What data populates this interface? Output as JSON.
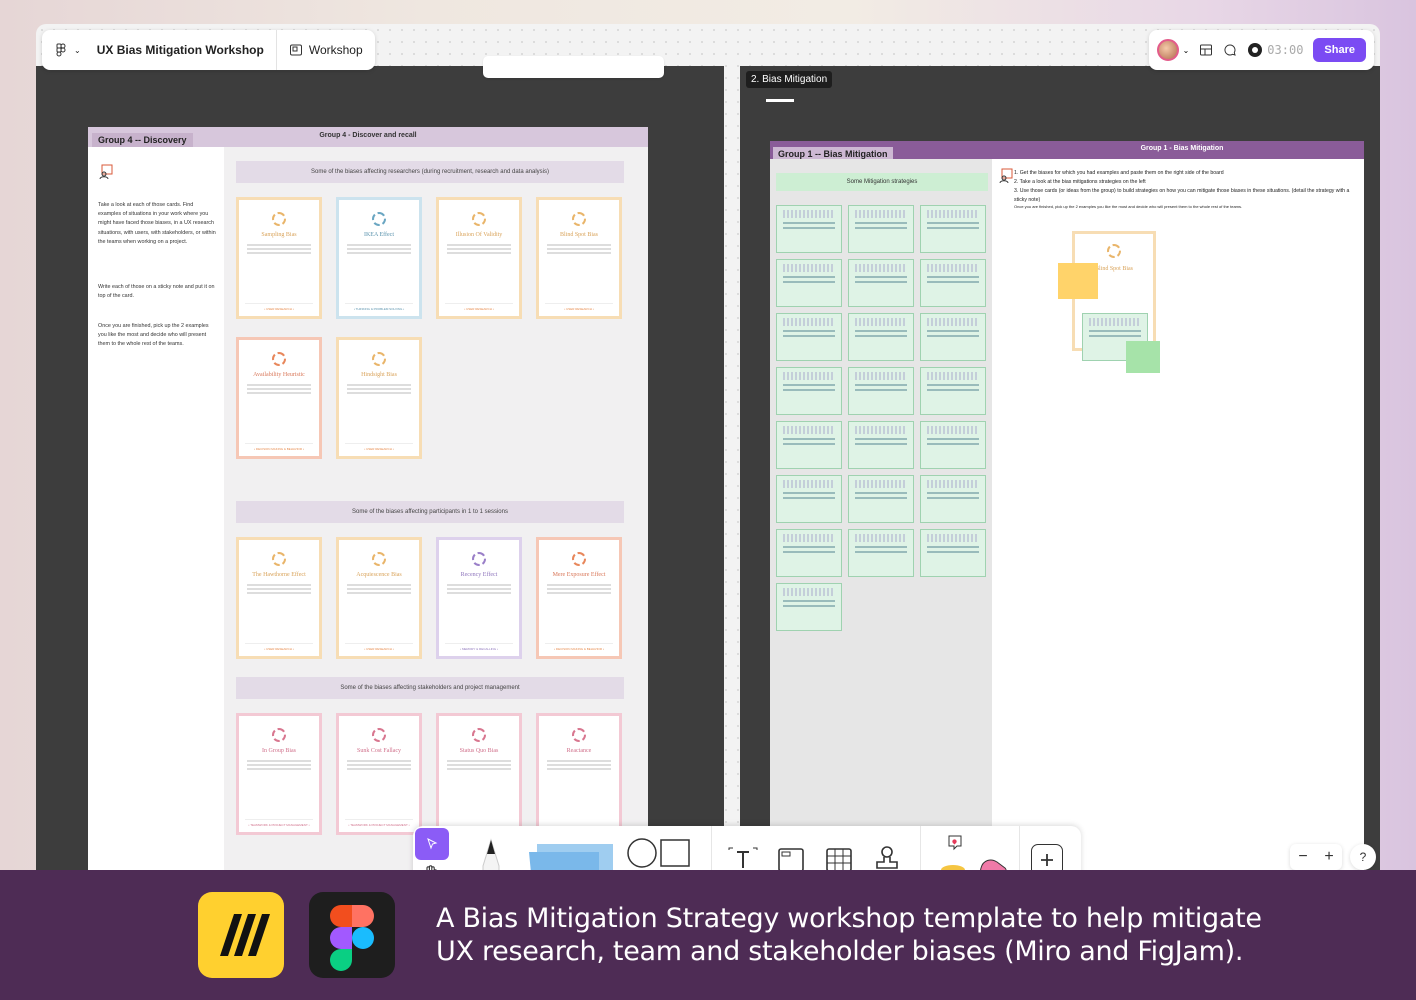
{
  "app": {
    "file_name": "UX Bias Mitigation Workshop",
    "mode_label": "Workshop",
    "timer": "03:00",
    "share_label": "Share"
  },
  "frame_b_label": "2. Bias Mitigation",
  "board_a": {
    "tab": "Group 4 -- Discovery",
    "header": "Group 4 - Discover and recall",
    "side_texts": [
      "Take a look at each of those cards. Find examples of situations in your work where you might have faced those biases, in a UX research situations, with users, with stakeholders, or within the teams when working on a project.",
      "Write each of those on a sticky note and put it on top of the card.",
      "Once you are finished, pick up the 2 examples you like the most and decide who will present them to the whole rest of the teams."
    ],
    "sections": [
      "Some of the biases affecting researchers (during recruitment, research and data analysis)",
      "Some of the biases affecting participants in 1 to 1 sessions",
      "Some of the biases affecting stakeholders and project management"
    ],
    "cards_row1": [
      "Sampling Bias",
      "IKEA Effect",
      "Illusion Of Validity",
      "Blind Spot Bias"
    ],
    "cards_row2": [
      "Availability Heuristic",
      "Hindsight Bias"
    ],
    "cards_row3": [
      "The Hawthorne Effect",
      "Acquiescence Bias",
      "Recency Effect",
      "Mere Exposure Effect"
    ],
    "cards_row4": [
      "In Group Bias",
      "Sunk Cost Fallacy",
      "Status Quo Bias",
      "Reactance"
    ]
  },
  "board_b": {
    "tab": "Group 1 -- Bias Mitigation",
    "header": "Group 1 - Bias Mitigation",
    "section": "Some Mitigation strategies",
    "instructions": [
      "1.  Get the biases for which you had examples and paste them on the right side of the board",
      "2.  Take a look at the bias mitigations strategies on the left",
      "3.  Use those cards (or ideas from the group) to build strategies on how you can mitigate those biases in these situations. (detail the strategy with a sticky note)"
    ],
    "instruction_note": "Once you are finished, pick up the 2 examples you like the most and decide who will present them to the whole rest of the teams.",
    "pasted_card": "Blind Spot Bias"
  },
  "zoom": {
    "minus": "−",
    "plus": "+"
  },
  "help": "?",
  "footer": {
    "line1": "A Bias Mitigation Strategy  workshop template to help mitigate",
    "line2": "UX research, team and stakeholder biases (Miro and FigJam)."
  },
  "colors": {
    "accent": "#7b4bf3",
    "footer_bg": "#4e2c55",
    "miro": "#ffd02f"
  }
}
